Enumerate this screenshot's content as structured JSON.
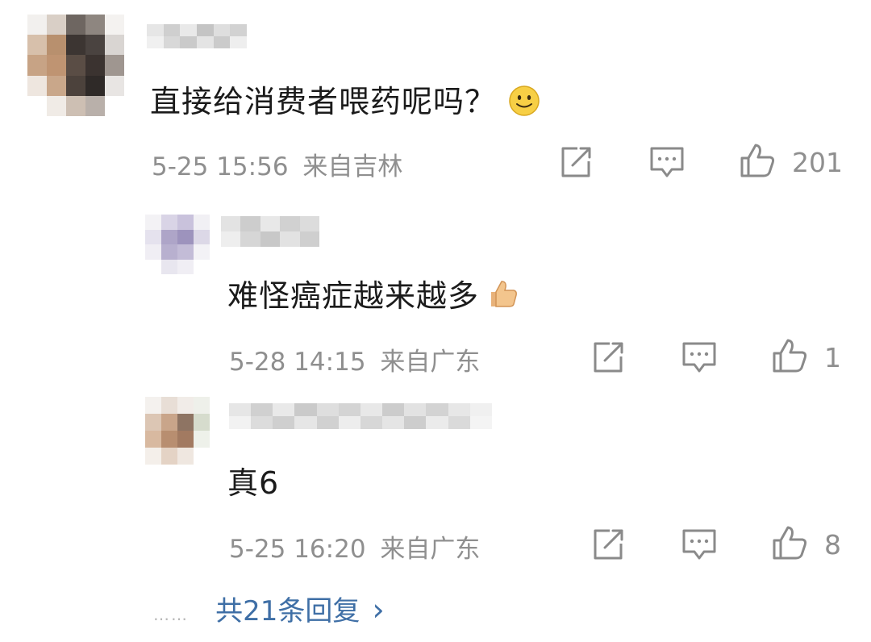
{
  "comment": {
    "text": "直接给消费者喂药呢吗？",
    "emoji_icon": "smile-emoji-icon",
    "time": "5-25 15:56",
    "location": "来自吉林",
    "likes": "201"
  },
  "replies": [
    {
      "text": "难怪癌症越来越多",
      "emoji_icon": "thumbs-up-emoji-icon",
      "time": "5-28 14:15",
      "location": "来自广东",
      "likes": "1"
    },
    {
      "text": "真6",
      "time": "5-25 16:20",
      "location": "来自广东",
      "likes": "8"
    }
  ],
  "more_replies": {
    "dots": "……",
    "label": "共21条回复",
    "chevron": "›"
  },
  "colors": {
    "text": "#1b1b1b",
    "meta": "#8f8f8f",
    "link": "#3f6fa6",
    "icon": "#8a8a8a"
  }
}
